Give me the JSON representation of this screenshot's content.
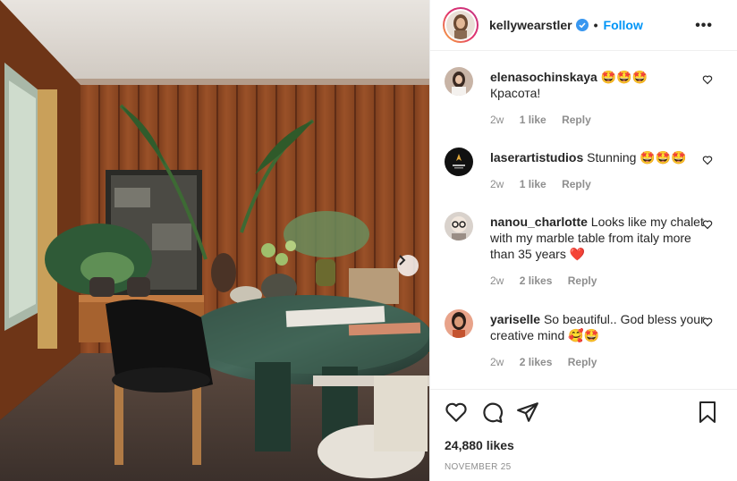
{
  "post": {
    "image_alt": "Dining room with wood paneling, marble table and plants",
    "next_label": "›"
  },
  "header": {
    "username": "kellywearstler",
    "verified": true,
    "separator": "•",
    "follow_label": "Follow",
    "more_label": "•••"
  },
  "comments": [
    {
      "username": "elenasochinskaya",
      "text": "🤩🤩🤩\nКрасота!",
      "inline": " 🤩🤩🤩",
      "second_line": "Красота!",
      "age": "2w",
      "likes": "1 like",
      "reply": "Reply",
      "avatar_color": "#c8b4a6"
    },
    {
      "username": "laserartistudios",
      "inline": " Stunning 🤩🤩🤩",
      "second_line": "",
      "age": "2w",
      "likes": "1 like",
      "reply": "Reply",
      "avatar_color": "#111111"
    },
    {
      "username": "nanou_charlotte",
      "inline": " Looks like my chalet with my marble table from italy more than 35 years ❤️",
      "second_line": "",
      "age": "2w",
      "likes": "2 likes",
      "reply": "Reply",
      "avatar_color": "#d9d2cc"
    },
    {
      "username": "yariselle",
      "inline": " So beautiful.. God bless your creative mind 🥰🤩",
      "second_line": "",
      "age": "2w",
      "likes": "2 likes",
      "reply": "Reply",
      "avatar_color": "#e8a38a"
    }
  ],
  "footer": {
    "likes": "24,880 likes",
    "date": "NOVEMBER 25"
  },
  "colors": {
    "accent": "#0095f6",
    "muted": "#8e8e8e",
    "text": "#262626",
    "divider": "#efefef"
  }
}
